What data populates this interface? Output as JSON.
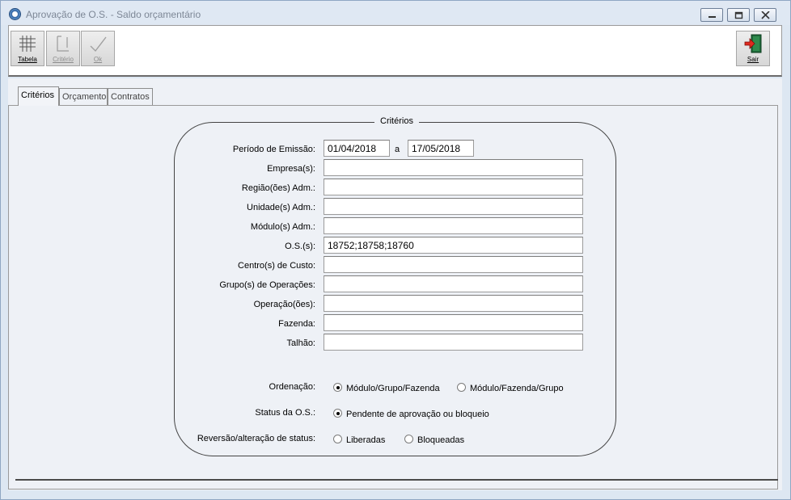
{
  "window": {
    "title": "Aprovação de O.S. - Saldo orçamentário"
  },
  "toolbar": {
    "buttons": [
      {
        "label": "Tabela",
        "icon": "grid-icon",
        "enabled": true
      },
      {
        "label": "Critério",
        "icon": "criteria-icon",
        "enabled": false
      },
      {
        "label": "Ok",
        "icon": "check-icon",
        "enabled": false
      },
      {
        "label": "Sair",
        "icon": "exit-door-icon",
        "enabled": true
      }
    ]
  },
  "tabs": [
    {
      "label": "Critérios",
      "active": true
    },
    {
      "label": "Orçamento",
      "active": false
    },
    {
      "label": "Contratos",
      "active": false
    }
  ],
  "criteria": {
    "group_title": "Critérios",
    "periodo": {
      "label": "Período de Emissão:",
      "from": "01/04/2018",
      "separator": "a",
      "to": "17/05/2018"
    },
    "fields": [
      {
        "label": "Empresa(s):",
        "value": ""
      },
      {
        "label": "Região(ões) Adm.:",
        "value": ""
      },
      {
        "label": "Unidade(s) Adm.:",
        "value": ""
      },
      {
        "label": "Módulo(s) Adm.:",
        "value": ""
      },
      {
        "label": "O.S.(s):",
        "value": "18752;18758;18760"
      },
      {
        "label": "Centro(s) de Custo:",
        "value": ""
      },
      {
        "label": "Grupo(s) de Operações:",
        "value": ""
      },
      {
        "label": "Operação(ões):",
        "value": ""
      },
      {
        "label": "Fazenda:",
        "value": ""
      },
      {
        "label": "Talhão:",
        "value": ""
      }
    ],
    "ordenacao": {
      "label": "Ordenação:",
      "options": [
        {
          "label": "Módulo/Grupo/Fazenda",
          "selected": true
        },
        {
          "label": "Módulo/Fazenda/Grupo",
          "selected": false
        }
      ]
    },
    "status": {
      "label": "Status da O.S.:",
      "options": [
        {
          "label": "Pendente de aprovação ou bloqueio",
          "selected": true
        }
      ]
    },
    "reversao": {
      "label": "Reversão/alteração de status:",
      "options": [
        {
          "label": "Liberadas",
          "selected": false
        },
        {
          "label": "Bloqueadas",
          "selected": false
        }
      ]
    }
  }
}
